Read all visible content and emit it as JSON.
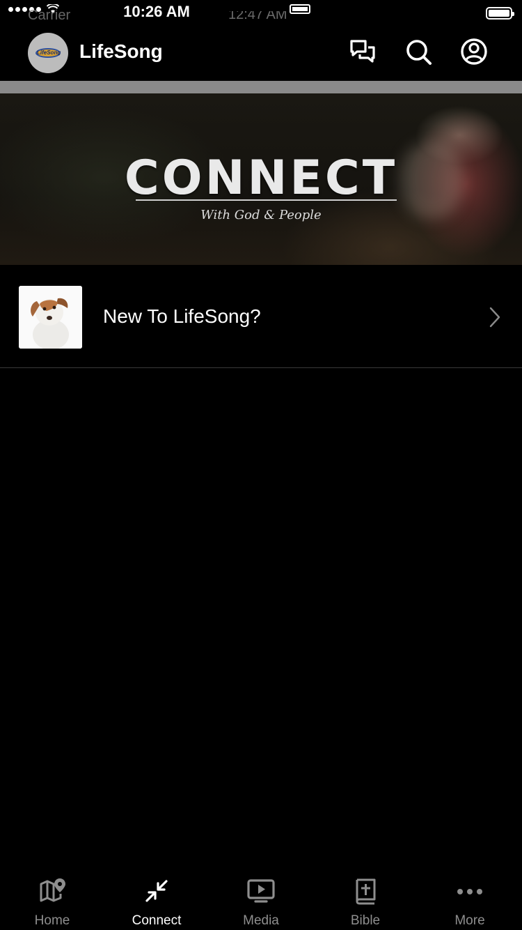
{
  "status_bar": {
    "time": "10:26 AM",
    "carrier_ghost": "Carrier",
    "time_ghost": "12:47 AM"
  },
  "header": {
    "app_title": "LifeSong",
    "logo_text": "LifeSong",
    "icons": [
      "chat-icon",
      "search-icon",
      "profile-icon"
    ]
  },
  "banner": {
    "title": "CONNECT",
    "subtitle": "With God & People"
  },
  "list": {
    "items": [
      {
        "label": "New To LifeSong?",
        "thumbnail": "dog-photo",
        "icon": "chevron-right-icon"
      }
    ]
  },
  "tabs": [
    {
      "label": "Home",
      "icon": "map-icon",
      "active": false
    },
    {
      "label": "Connect",
      "icon": "arrows-in-icon",
      "active": true
    },
    {
      "label": "Media",
      "icon": "tv-play-icon",
      "active": false
    },
    {
      "label": "Bible",
      "icon": "bible-icon",
      "active": false
    },
    {
      "label": "More",
      "icon": "more-dots-icon",
      "active": false
    }
  ],
  "colors": {
    "background": "#000000",
    "active_tab": "#ffffff",
    "inactive_tab": "#8e8e8e",
    "divider": "#8a8a8a"
  }
}
